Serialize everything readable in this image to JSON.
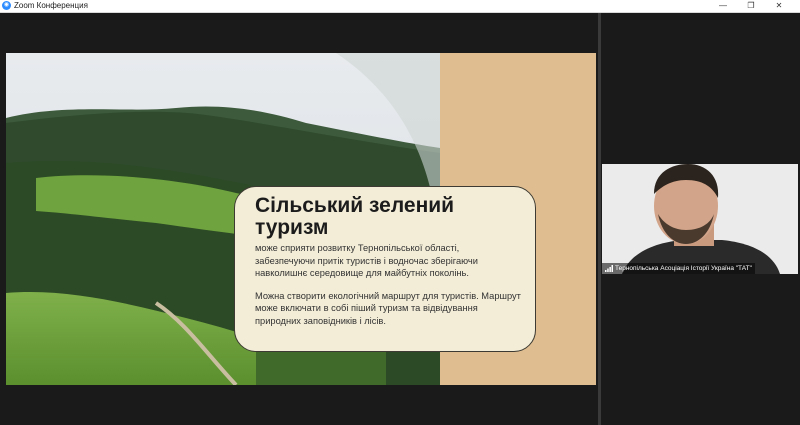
{
  "window": {
    "title": "Zoom Конференция",
    "app_icon": "zoom-icon",
    "controls": {
      "minimize": "—",
      "restore": "❐",
      "close": "✕"
    }
  },
  "slide": {
    "title": "Сільський зелений туризм",
    "paragraph1": "може сприяти розвитку Тернопільської області, забезпечуючи притік туристів і водночас зберігаючи навколишнє середовище для майбутніх поколінь.",
    "paragraph2": "Можна створити екологічний маршрут для туристів. Маршрут може включати в собі піший туризм та відвідування природних заповідників і лісів.",
    "colors": {
      "card": "#f3edd7",
      "accent": "#dfbd90",
      "accent_dark": "#cfa77a"
    }
  },
  "participant": {
    "name": "Тернопільська Асоціація Історії Україна \"ТАТ\"",
    "signal_icon": "signal-bars-icon"
  }
}
